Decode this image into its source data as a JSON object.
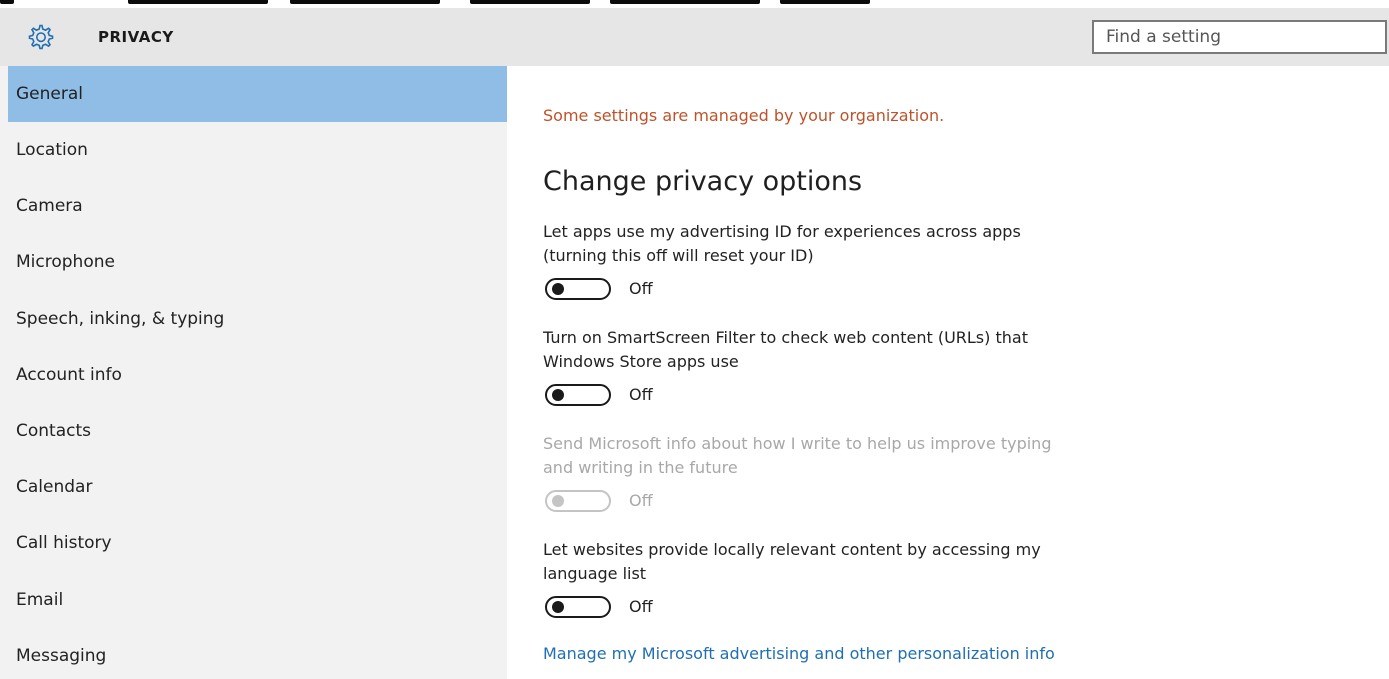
{
  "header": {
    "title": "PRIVACY",
    "icon": "gear-icon",
    "search_placeholder": "Find a setting"
  },
  "sidebar": {
    "items": [
      {
        "label": "General",
        "active": true
      },
      {
        "label": "Location"
      },
      {
        "label": "Camera"
      },
      {
        "label": "Microphone"
      },
      {
        "label": "Speech, inking, & typing"
      },
      {
        "label": "Account info"
      },
      {
        "label": "Contacts"
      },
      {
        "label": "Calendar"
      },
      {
        "label": "Call history"
      },
      {
        "label": "Email"
      },
      {
        "label": "Messaging"
      }
    ]
  },
  "main": {
    "notice": "Some settings are managed by your organization.",
    "heading": "Change privacy options",
    "options": [
      {
        "line1": "Let apps use my advertising ID for experiences across apps",
        "line2": "(turning this off will reset your ID)",
        "state": "Off",
        "enabled": true
      },
      {
        "line1": "Turn on SmartScreen Filter to check web content (URLs) that",
        "line2": "Windows Store apps use",
        "state": "Off",
        "enabled": true
      },
      {
        "line1": "Send Microsoft info about how I write to help us improve typing",
        "line2": "and writing in the future",
        "state": "Off",
        "enabled": false
      },
      {
        "line1": "Let websites provide locally relevant content by accessing my",
        "line2": "language list",
        "state": "Off",
        "enabled": true
      }
    ],
    "link": "Manage my Microsoft advertising and other personalization info"
  },
  "colors": {
    "accent": "#8fbde6",
    "notice": "#c0522a",
    "link": "#1f6fb2",
    "header_bg": "#e6e6e6",
    "sidebar_bg": "#f2f2f2"
  }
}
